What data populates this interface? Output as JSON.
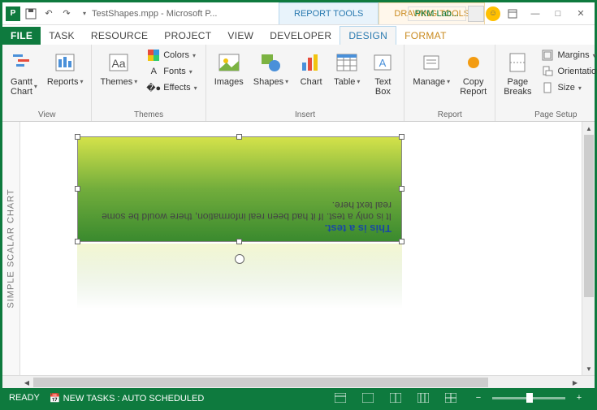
{
  "titlebar": {
    "title": "TestShapes.mpp - Microsoft P...",
    "context_report": "REPORT TOOLS",
    "context_drawing": "DRAWING TOOLS",
    "pkm": "PKM Lab..."
  },
  "tabs": {
    "file": "FILE",
    "task": "TASK",
    "resource": "RESOURCE",
    "project": "PROJECT",
    "view": "VIEW",
    "developer": "DEVELOPER",
    "design": "DESIGN",
    "format": "FORMAT"
  },
  "ribbon": {
    "view": {
      "gantt_chart": "Gantt\nChart",
      "reports": "Reports",
      "label": "View"
    },
    "themes": {
      "themes": "Themes",
      "colors": "Colors",
      "fonts": "Fonts",
      "effects": "Effects",
      "label": "Themes"
    },
    "insert": {
      "images": "Images",
      "shapes": "Shapes",
      "chart": "Chart",
      "table": "Table",
      "textbox": "Text\nBox",
      "label": "Insert"
    },
    "report": {
      "manage": "Manage",
      "copy_report": "Copy\nReport",
      "label": "Report"
    },
    "page_setup": {
      "page_breaks": "Page\nBreaks",
      "margins": "Margins",
      "orientation": "Orientation",
      "size": "Size",
      "label": "Page Setup"
    }
  },
  "side_panel_title": "SIMPLE SCALAR CHART",
  "shape": {
    "title": "This is a test.",
    "body": "It is only a test. If it had been real information, there would be some real text here."
  },
  "statusbar": {
    "ready": "READY",
    "newtasks": "NEW TASKS : AUTO SCHEDULED"
  }
}
